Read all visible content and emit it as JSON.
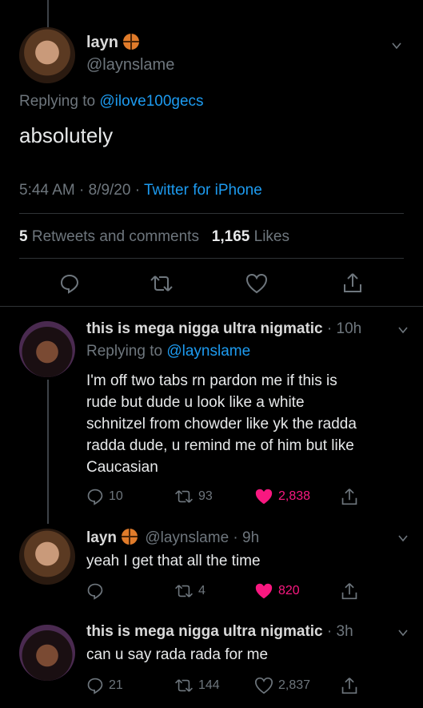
{
  "main_tweet": {
    "display_name": "layn",
    "handle": "@laynslame",
    "replying_label": "Replying to",
    "replying_to": "@ilove100gecs",
    "text": "absolutely",
    "time": "5:44 AM · 8/9/20 ·",
    "client": "Twitter for iPhone",
    "retweets_count": "5",
    "retweets_label": "Retweets and comments",
    "likes_count": "1,165",
    "likes_label": "Likes"
  },
  "replies": [
    {
      "display_name": "this is mega nigga ultra nigmatic",
      "time": "· 10h",
      "replying_label": "Replying to",
      "replying_to": "@laynslame",
      "text_lines": [
        "I'm off two tabs rn pardon me if this is",
        "rude but dude u look like a white",
        "schnitzel from chowder like yk the radda",
        "radda dude, u remind me of him but like",
        "Caucasian"
      ],
      "replies": "10",
      "retweets": "93",
      "likes": "2,838",
      "liked": true
    },
    {
      "display_name": "layn",
      "handle": "@laynslame · 9h",
      "text": "yeah I get that all the time",
      "replies": "",
      "retweets": "4",
      "likes": "820",
      "liked": true
    },
    {
      "display_name": "this is mega nigga ultra nigmatic",
      "time": "· 3h",
      "text": "can u say rada rada for me",
      "replies": "21",
      "retweets": "144",
      "likes": "2,837",
      "liked": false
    }
  ],
  "colors": {
    "accent": "#1d9bf0",
    "liked": "#f91880",
    "muted": "#6e767d"
  }
}
